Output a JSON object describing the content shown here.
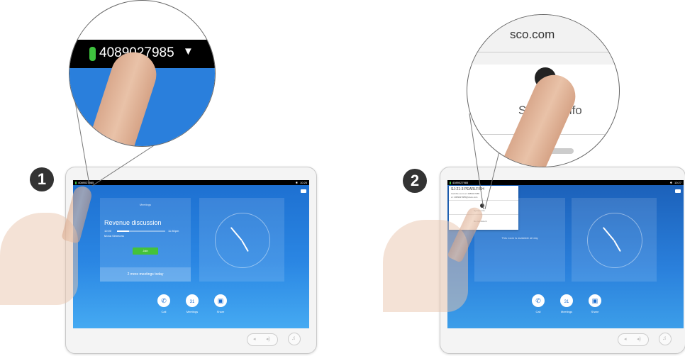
{
  "step1": {
    "badge": "1",
    "zoom_number": "4089027985",
    "status_number": "4089027985",
    "status_time": "10:26",
    "meetings_header": "Meetings",
    "meeting_title": "Revenue discussion",
    "meeting_start": "10:00",
    "meeting_end": "11:30pm",
    "meeting_host": "Mona Simmons",
    "join_label": "Join",
    "more_meetings": "2 more meetings today",
    "buttons": {
      "call": "Call",
      "meetings": "Meetings",
      "share": "Share"
    },
    "meetings_icon_text": "31"
  },
  "step2": {
    "badge": "2",
    "zoom_domain": "sco.com",
    "zoom_system_info": "System Info",
    "status_number": "4089027985",
    "status_time": "10:27",
    "popup_title": "SJ-21-3 PEARLFISH",
    "popup_line1": "Call this room at: 4089027985",
    "popup_line2": "or: 4089027985@cisco.com",
    "popup_item1": "System Info",
    "popup_item2": "Do not disturb",
    "available_text": "This room is available all day",
    "buttons": {
      "call": "Call",
      "meetings": "Meetings",
      "share": "Share"
    },
    "meetings_icon_text": "31"
  },
  "colors": {
    "screen_blue": "#1d6fd0",
    "join_green": "#44c23a",
    "status_green": "#3ec13e"
  }
}
